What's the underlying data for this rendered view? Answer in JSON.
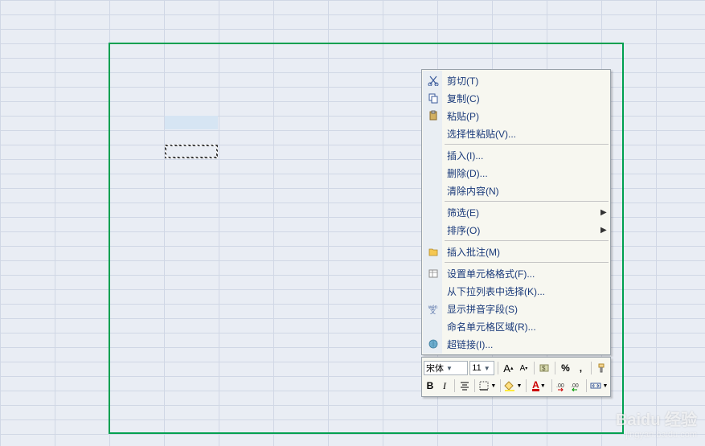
{
  "menu": {
    "cut": "剪切(T)",
    "copy": "复制(C)",
    "paste": "粘贴(P)",
    "paste_special": "选择性粘贴(V)...",
    "insert": "插入(I)...",
    "delete": "删除(D)...",
    "clear": "清除内容(N)",
    "filter": "筛选(E)",
    "sort": "排序(O)",
    "comment": "插入批注(M)",
    "format_cells": "设置单元格格式(F)...",
    "pick_from_list": "从下拉列表中选择(K)...",
    "phonetic": "显示拼音字段(S)",
    "name_range": "命名单元格区域(R)...",
    "hyperlink": "超链接(I)..."
  },
  "mini_toolbar": {
    "font_name": "宋体",
    "font_size": "11"
  },
  "watermark": {
    "main": "Baidu 经验",
    "sub": "jingyan.baidu.com"
  }
}
